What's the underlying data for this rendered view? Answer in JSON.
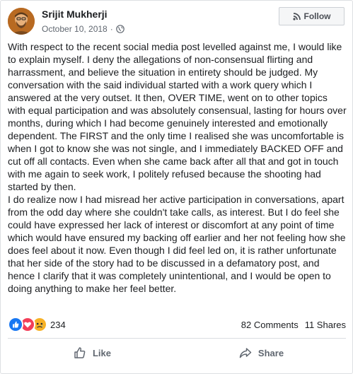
{
  "post": {
    "author": "Srijit Mukherji",
    "date": "October 10, 2018",
    "separator": "·",
    "privacy_icon": "globe-icon",
    "follow_label": "Follow",
    "follow_icon": "rss-icon",
    "body": "With respect to the recent social media post levelled against me, I would like to explain myself. I deny the allegations of non-consensual flirting and harrassment, and believe the situation in entirety should be judged. My conversation with the said individual started with a work query which I answered at the very outset. It then, OVER TIME, went on to other topics with equal participation and was absolutely consensual, lasting for hours over months, during which I had become genuinely interested and emotionally dependent. The FIRST and the only time I realised she was uncomfortable is when I got to know she was not single, and I immediately BACKED OFF and cut off all contacts. Even when she came back after all that and got in touch with me again to seek work, I politely refused because the shooting had started by then.\nI do realize now I had misread her active participation in conversations, apart from the odd day where she couldn't take calls, as interest. But I do feel she could have expressed her lack of interest or discomfort at any point of time which would have ensured my backing off earlier and her not feeling how she does feel about it now. Even though I did feel led on, it is rather unfortunate that her side of the story had to be discussed in a defamatory post, and hence I clarify that it was completely unintentional, and I would be open to doing anything to make her feel better."
  },
  "stats": {
    "reaction_icons": [
      "like-reaction-icon",
      "love-reaction-icon",
      "sad-reaction-icon"
    ],
    "reaction_count": "234",
    "comments": "82 Comments",
    "shares": "11 Shares"
  },
  "actions": {
    "like_label": "Like",
    "like_icon": "thumbs-up-icon",
    "share_label": "Share",
    "share_icon": "share-arrow-icon"
  },
  "colors": {
    "like_blue": "#1877f2",
    "love_red": "#f33e58",
    "sad_yellow": "#f7b125",
    "secondary_text": "#606770"
  }
}
